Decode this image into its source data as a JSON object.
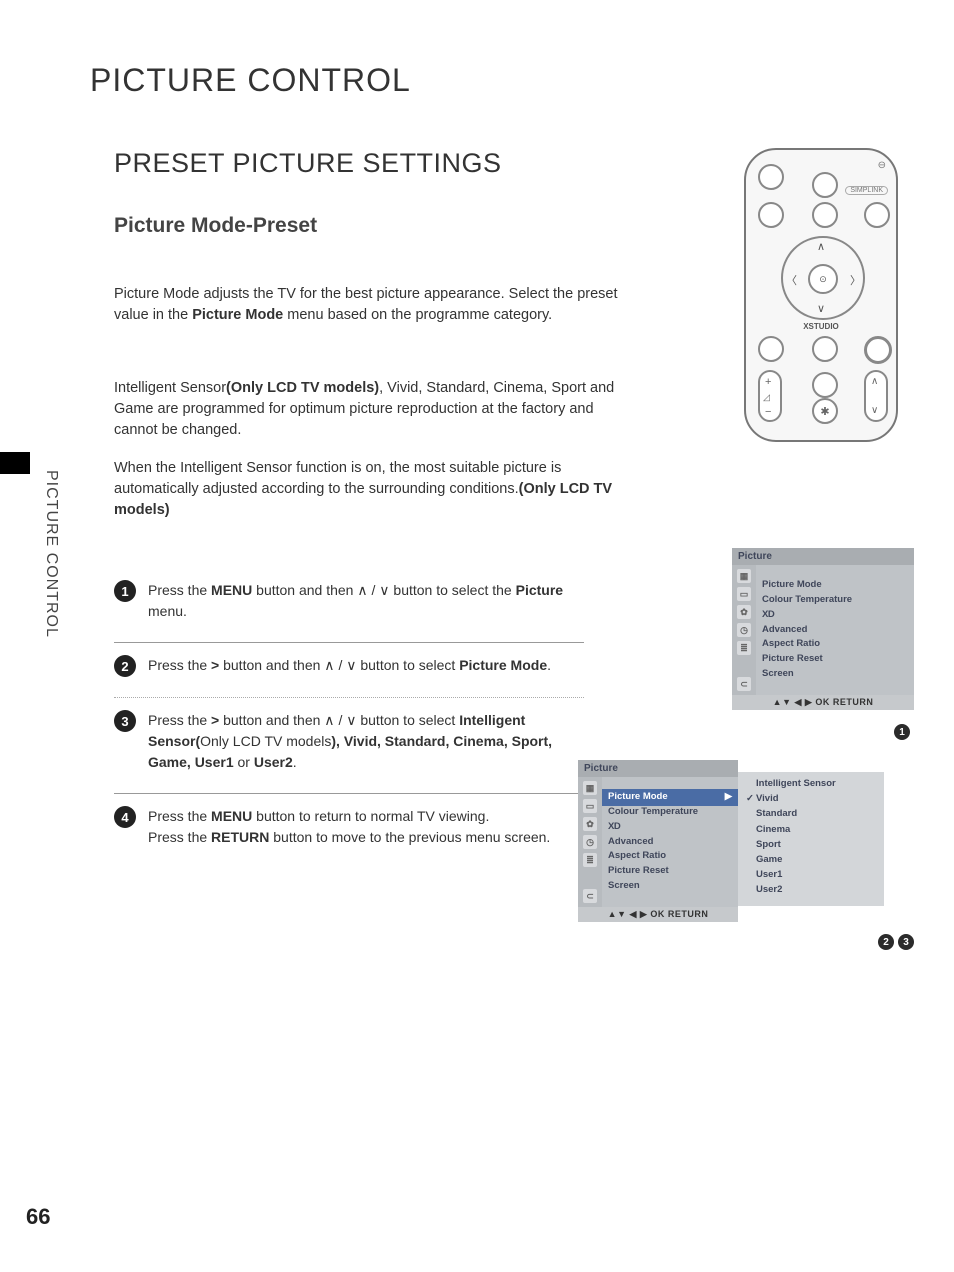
{
  "page": {
    "number": "66",
    "side_tab": "PICTURE CONTROL",
    "h1": "PICTURE CONTROL",
    "h2": "PRESET PICTURE SETTINGS",
    "h3": "Picture Mode-Preset"
  },
  "intro": {
    "p1a": "Picture Mode adjusts the TV for the best picture appearance. Select the preset value in the ",
    "p1b": "Picture Mode",
    "p1c": " menu based on the programme category.",
    "p2a": "Intelligent Sensor",
    "p2b": "(Only LCD TV models)",
    "p2c": ", Vivid, Standard, Cinema, Sport and Game are programmed for optimum picture reproduction at the factory and cannot be changed.",
    "p3a": "When the Intelligent Sensor function is on, the most suitable picture is automatically adjusted according to the surrounding conditions.",
    "p3b": "(Only LCD TV models)"
  },
  "steps": {
    "s1": {
      "n": "1",
      "a": "Press the ",
      "b": "MENU",
      "c": " button and then  ∧ / ∨  button to select the ",
      "d": "Picture",
      "e": "  menu."
    },
    "s2": {
      "n": "2",
      "a": "Press the  ",
      "b": ">",
      "c": "  button and then  ∧ / ∨  button to select ",
      "d": "Picture Mode",
      "e": "."
    },
    "s3": {
      "n": "3",
      "a": "Press the  ",
      "b": ">",
      "c": "  button and then  ∧ / ∨  button to select ",
      "d": "Intelligent Sensor(",
      "e": "Only LCD TV models",
      "f": "), ",
      "g": "Vivid, Standard, Cinema, Sport, Game, User1",
      "h": " or ",
      "i": "User2",
      "j": "."
    },
    "s4": {
      "n": "4",
      "a": "Press the ",
      "b": "MENU",
      "c": " button to return to normal TV viewing.",
      "d": "Press the ",
      "e": "RETURN",
      "f": " button to move to the previous menu screen."
    }
  },
  "remote": {
    "label_studio": "XSTUDIO"
  },
  "osd": {
    "title": "Picture",
    "items": [
      "Picture Mode",
      "Colour Temperature",
      "XD",
      "Advanced",
      "Aspect Ratio",
      "Picture Reset",
      "Screen"
    ],
    "footer": "▲▼  ◀ ▶   OK   RETURN",
    "sub_arrow": "▶"
  },
  "submenu": {
    "items": [
      "Intelligent Sensor",
      "Vivid",
      "Standard",
      "Cinema",
      "Sport",
      "Game",
      "User1",
      "User2"
    ],
    "check": "✓"
  },
  "callouts": {
    "c1": "1",
    "c2": "2",
    "c3": "3"
  }
}
